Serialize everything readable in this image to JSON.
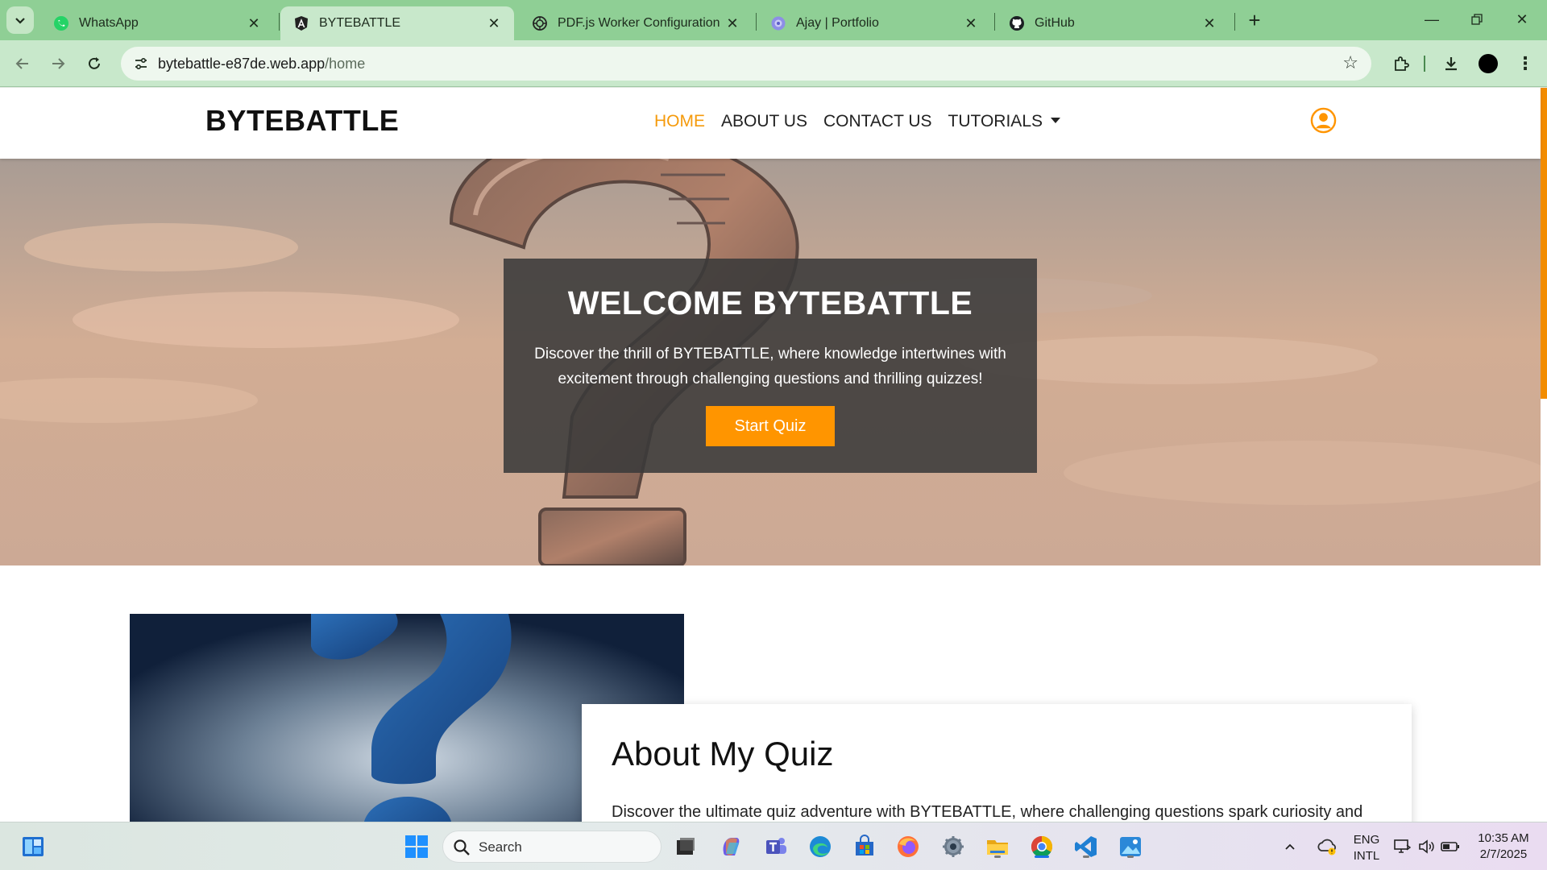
{
  "browser": {
    "tabs": [
      {
        "title": "WhatsApp",
        "icon": "whatsapp-icon",
        "active": false
      },
      {
        "title": "BYTEBATTLE",
        "icon": "angular-icon",
        "active": true
      },
      {
        "title": "PDF.js Worker Configuration",
        "icon": "openai-icon",
        "active": false
      },
      {
        "title": "Ajay | Portfolio",
        "icon": "portfolio-icon",
        "active": false
      },
      {
        "title": "GitHub",
        "icon": "github-icon",
        "active": false
      }
    ],
    "url_host": "bytebattle-e87de.web.app",
    "url_path": "/home"
  },
  "site": {
    "brand": "BYTEBATTLE",
    "nav": [
      {
        "label": "HOME",
        "current": true
      },
      {
        "label": "ABOUT US",
        "current": false
      },
      {
        "label": "CONTACT US",
        "current": false
      },
      {
        "label": "TUTORIALS",
        "current": false
      }
    ],
    "accent": "#ff9500"
  },
  "hero": {
    "title": "WELCOME BYTEBATTLE",
    "text": "Discover the thrill of BYTEBATTLE, where knowledge intertwines with excitement through challenging questions and thrilling quizzes!",
    "button": "Start Quiz"
  },
  "about": {
    "title": "About My Quiz",
    "text": "Discover the ultimate quiz adventure with BYTEBATTLE, where challenging questions spark curiosity and thrilling quizzes test your knowledge. Join our community of learners and challenge yourself today!"
  },
  "taskbar": {
    "search": "Search",
    "lang_top": "ENG",
    "lang_bottom": "INTL",
    "time": "10:35 AM",
    "date": "2/7/2025"
  }
}
